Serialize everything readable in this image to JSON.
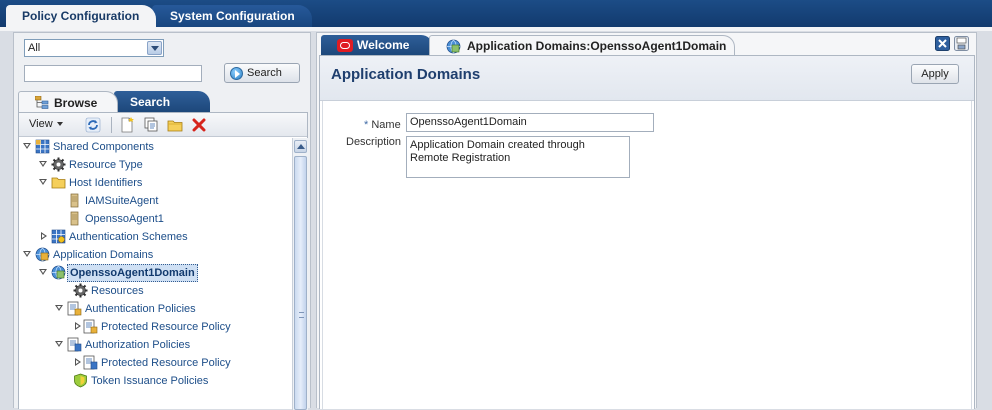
{
  "top_tabs": {
    "policy": "Policy Configuration",
    "system": "System Configuration"
  },
  "left": {
    "filter_select": "All",
    "search_button": "Search",
    "browse_tab": "Browse",
    "search_tab": "Search",
    "view_menu": "View"
  },
  "tree": {
    "items": [
      {
        "label": "Shared Components"
      },
      {
        "label": "Resource Type"
      },
      {
        "label": "Host Identifiers"
      },
      {
        "label": "IAMSuiteAgent"
      },
      {
        "label": "OpenssoAgent1"
      },
      {
        "label": "Authentication Schemes"
      },
      {
        "label": "Application Domains"
      },
      {
        "label": "OpenssoAgent1Domain"
      },
      {
        "label": "Resources"
      },
      {
        "label": "Authentication Policies"
      },
      {
        "label": "Protected Resource Policy"
      },
      {
        "label": "Authorization Policies"
      },
      {
        "label": "Protected Resource Policy"
      },
      {
        "label": "Token Issuance Policies"
      }
    ]
  },
  "content_tabs": {
    "welcome": "Welcome",
    "app_domain": "Application Domains:OpenssoAgent1Domain"
  },
  "form": {
    "title": "Application Domains",
    "apply": "Apply",
    "required_mark": "*",
    "name_label": "Name",
    "name_value": "OpenssoAgent1Domain",
    "description_label": "Description",
    "description_value": "Application Domain created through Remote Registration"
  },
  "colors": {
    "nav_bg": "#123a6e",
    "link_text": "#1d4e89",
    "close_red": "#d6241c"
  }
}
